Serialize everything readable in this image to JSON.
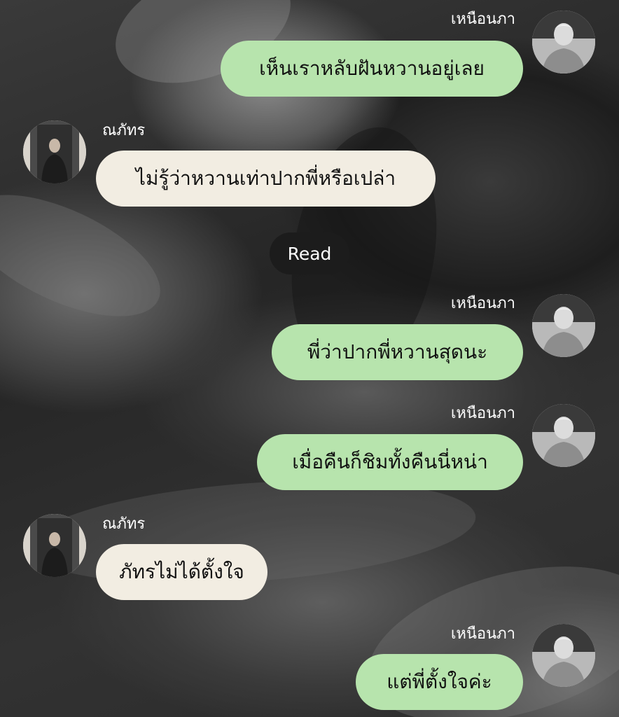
{
  "participants": {
    "me": {
      "name": "เหนือนภา"
    },
    "them": {
      "name": "ณภัทร"
    }
  },
  "messages": [
    {
      "sender": "me",
      "name": "เหนือนภา",
      "text": "เห็นเราหลับฝันหวานอยู่เลย"
    },
    {
      "sender": "them",
      "name": "ณภัทร",
      "text": "ไม่รู้ว่าหวานเท่าปากพี่หรือเปล่า"
    },
    {
      "sender": "me",
      "name": "เหนือนภา",
      "text": "พี่ว่าปากพี่หวานสุดนะ"
    },
    {
      "sender": "me",
      "name": "เหนือนภา",
      "text": "เมื่อคืนก็ชิมทั้งคืนนี่หน่า"
    },
    {
      "sender": "them",
      "name": "ณภัทร",
      "text": "ภัทรไม่ได้ตั้งใจ"
    },
    {
      "sender": "me",
      "name": "เหนือนภา",
      "text": "แต่พี่ตั้งใจค่ะ"
    }
  ],
  "read_label": "Read",
  "colors": {
    "me_bubble": "#b7e4ad",
    "them_bubble": "#f2ede2",
    "read_pill": "#1c1c1c",
    "name_text": "#ffffff"
  }
}
